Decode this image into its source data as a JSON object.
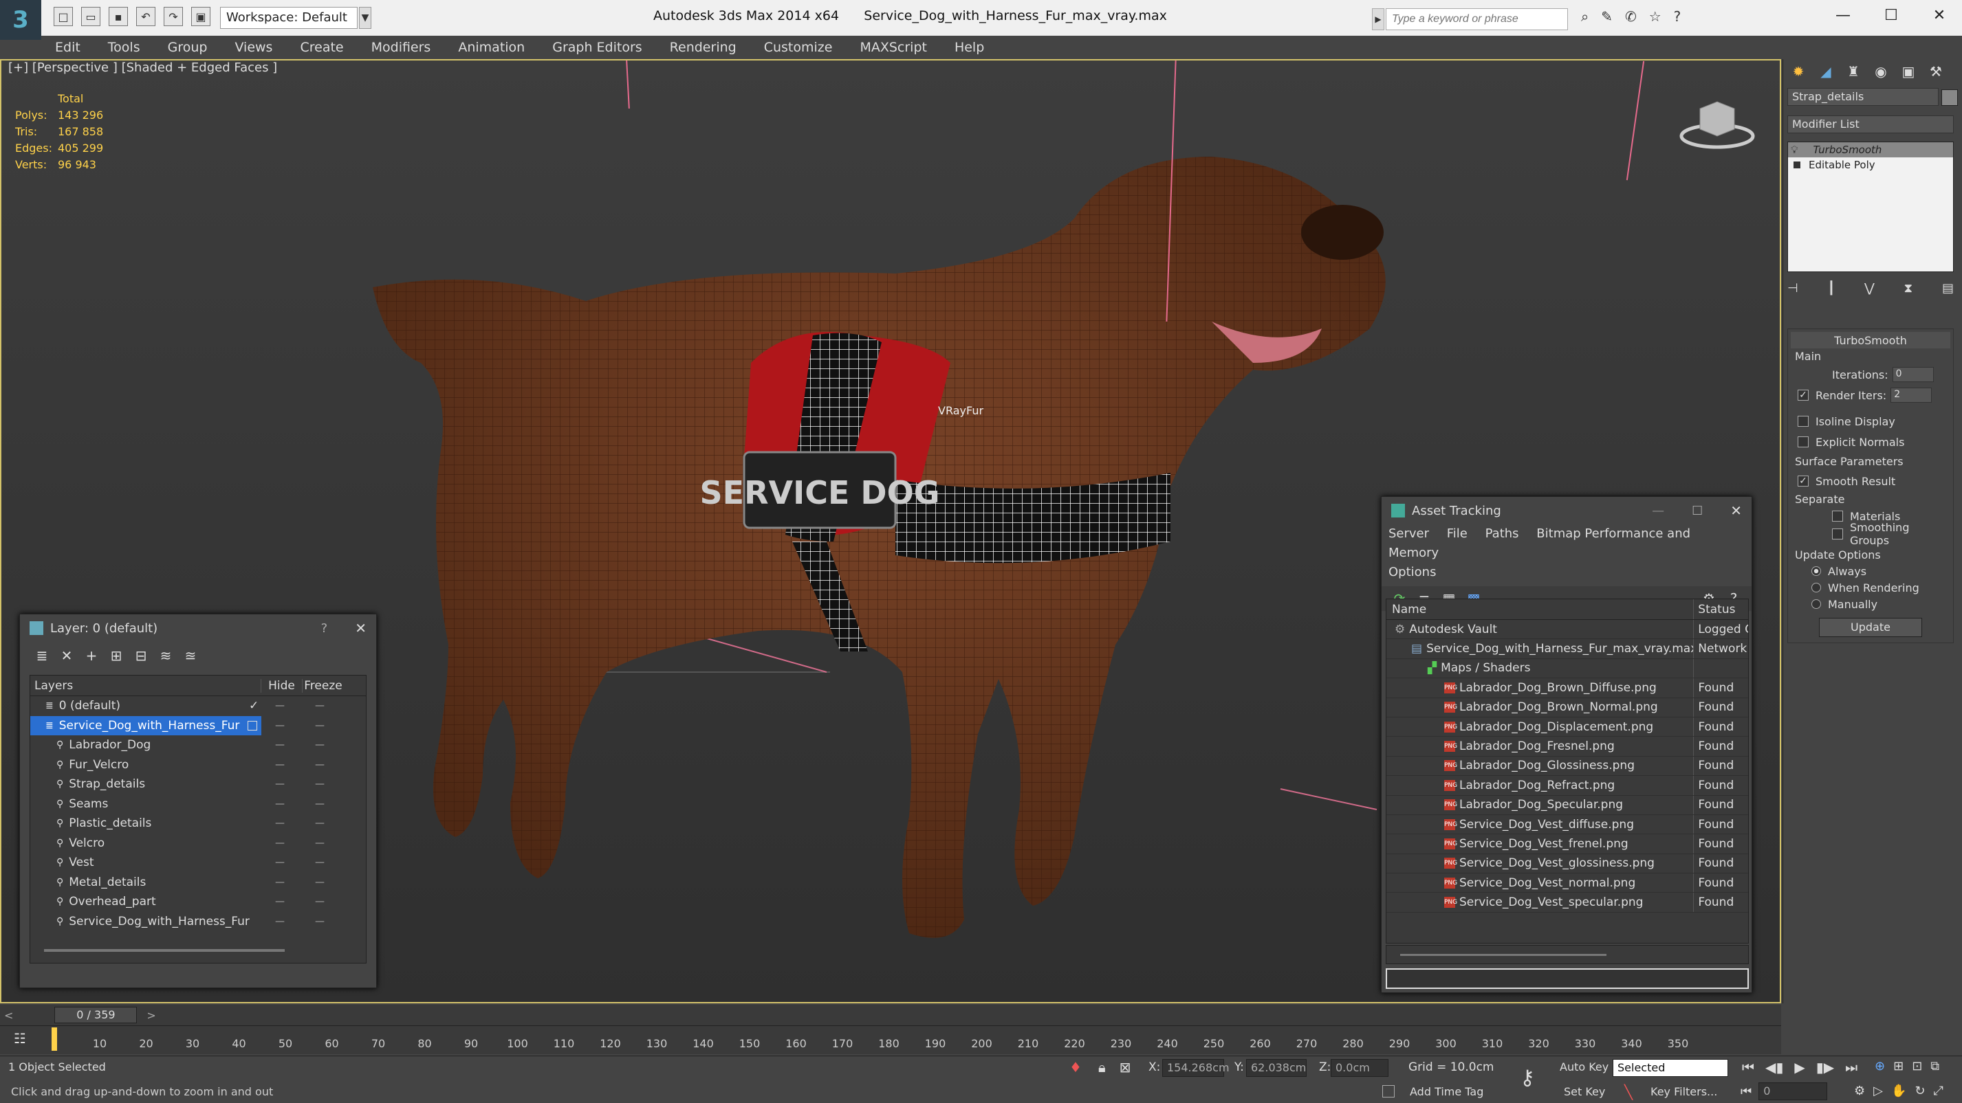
{
  "titlebar": {
    "workspace": "Workspace: Default",
    "app": "Autodesk 3ds Max  2014 x64",
    "file": "Service_Dog_with_Harness_Fur_max_vray.max",
    "search_placeholder": "Type a keyword or phrase"
  },
  "menu": [
    "Edit",
    "Tools",
    "Group",
    "Views",
    "Create",
    "Modifiers",
    "Animation",
    "Graph Editors",
    "Rendering",
    "Customize",
    "MAXScript",
    "Help"
  ],
  "viewport": {
    "label": "[+] [Perspective ] [Shaded + Edged Faces ]",
    "stats_header": "Total",
    "stats": [
      {
        "label": "Polys:",
        "value": "143 296"
      },
      {
        "label": "Tris:",
        "value": "167 858"
      },
      {
        "label": "Edges:",
        "value": "405 299"
      },
      {
        "label": "Verts:",
        "value": "96 943"
      }
    ],
    "vrayfur_label": "VRayFur",
    "vest_text": "SERVICE DOG"
  },
  "command_panel": {
    "object_name": "Strap_details",
    "modifier_list": "Modifier List",
    "stack": [
      {
        "label": "TurboSmooth",
        "italic": true
      },
      {
        "label": "Editable Poly",
        "italic": false
      }
    ],
    "rollout_title": "TurboSmooth",
    "main_label": "Main",
    "iterations_label": "Iterations:",
    "iterations_value": "0",
    "render_iters_label": "Render Iters:",
    "render_iters_value": "2",
    "isoline": "Isoline Display",
    "explicit_normals": "Explicit Normals",
    "surface_params": "Surface Parameters",
    "smooth_result": "Smooth Result",
    "separate": "Separate",
    "materials": "Materials",
    "smoothing_groups": "Smoothing Groups",
    "update_options": "Update Options",
    "always": "Always",
    "when_rendering": "When Rendering",
    "manually": "Manually",
    "update_button": "Update"
  },
  "layer_panel": {
    "title": "Layer: 0 (default)",
    "help": "?",
    "col_layers": "Layers",
    "col_hide": "Hide",
    "col_freeze": "Freeze",
    "rows": [
      {
        "name": "0 (default)",
        "indent": 1,
        "selected": false
      },
      {
        "name": "Service_Dog_with_Harness_Fur",
        "indent": 1,
        "selected": true
      },
      {
        "name": "Labrador_Dog",
        "indent": 2,
        "selected": false
      },
      {
        "name": "Fur_Velcro",
        "indent": 2,
        "selected": false
      },
      {
        "name": "Strap_details",
        "indent": 2,
        "selected": false
      },
      {
        "name": "Seams",
        "indent": 2,
        "selected": false
      },
      {
        "name": "Plastic_details",
        "indent": 2,
        "selected": false
      },
      {
        "name": "Velcro",
        "indent": 2,
        "selected": false
      },
      {
        "name": "Vest",
        "indent": 2,
        "selected": false
      },
      {
        "name": "Metal_details",
        "indent": 2,
        "selected": false
      },
      {
        "name": "Overhead_part",
        "indent": 2,
        "selected": false
      },
      {
        "name": "Service_Dog_with_Harness_Fur",
        "indent": 2,
        "selected": false
      }
    ]
  },
  "asset_tracking": {
    "title": "Asset Tracking",
    "menu": [
      "Server",
      "File",
      "Paths",
      "Bitmap Performance and Memory"
    ],
    "menu2": "Options",
    "col_name": "Name",
    "col_status": "Status",
    "rows": [
      {
        "name": "Autodesk Vault",
        "status": "Logged O",
        "indent": 1
      },
      {
        "name": "Service_Dog_with_Harness_Fur_max_vray.max",
        "status": "Network",
        "indent": 2
      },
      {
        "name": "Maps / Shaders",
        "status": "",
        "indent": 3
      },
      {
        "name": "Labrador_Dog_Brown_Diffuse.png",
        "status": "Found",
        "indent": 4
      },
      {
        "name": "Labrador_Dog_Brown_Normal.png",
        "status": "Found",
        "indent": 4
      },
      {
        "name": "Labrador_Dog_Displacement.png",
        "status": "Found",
        "indent": 4
      },
      {
        "name": "Labrador_Dog_Fresnel.png",
        "status": "Found",
        "indent": 4
      },
      {
        "name": "Labrador_Dog_Glossiness.png",
        "status": "Found",
        "indent": 4
      },
      {
        "name": "Labrador_Dog_Refract.png",
        "status": "Found",
        "indent": 4
      },
      {
        "name": "Labrador_Dog_Specular.png",
        "status": "Found",
        "indent": 4
      },
      {
        "name": "Service_Dog_Vest_diffuse.png",
        "status": "Found",
        "indent": 4
      },
      {
        "name": "Service_Dog_Vest_frenel.png",
        "status": "Found",
        "indent": 4
      },
      {
        "name": "Service_Dog_Vest_glossiness.png",
        "status": "Found",
        "indent": 4
      },
      {
        "name": "Service_Dog_Vest_normal.png",
        "status": "Found",
        "indent": 4
      },
      {
        "name": "Service_Dog_Vest_specular.png",
        "status": "Found",
        "indent": 4
      }
    ]
  },
  "timeline": {
    "frame": "0 / 359",
    "ticks": [
      "10",
      "20",
      "30",
      "40",
      "50",
      "60",
      "70",
      "80",
      "90",
      "100",
      "110",
      "120",
      "130",
      "140",
      "150",
      "160",
      "170",
      "180",
      "190",
      "200",
      "210",
      "220",
      "230",
      "240",
      "250",
      "260",
      "270",
      "280",
      "290",
      "300",
      "310",
      "320",
      "330",
      "340",
      "350"
    ]
  },
  "status": {
    "selected": "1 Object Selected",
    "prompt": "Click and drag up-and-down to zoom in and out",
    "x_label": "X:",
    "x_value": "154.268cm",
    "y_label": "Y:",
    "y_value": "62.038cm",
    "z_label": "Z:",
    "z_value": "0.0cm",
    "grid": "Grid = 10.0cm",
    "add_time_tag": "Add Time Tag",
    "auto_key": "Auto Key",
    "set_key": "Set Key",
    "selected_dropdown": "Selected",
    "key_filters": "Key Filters...",
    "frame_field": "0"
  },
  "colors": {
    "accent": "#2a6fd1",
    "stats": "#ffd24a",
    "viewport_border": "#d4c36a",
    "fur": "#6a3a22"
  }
}
